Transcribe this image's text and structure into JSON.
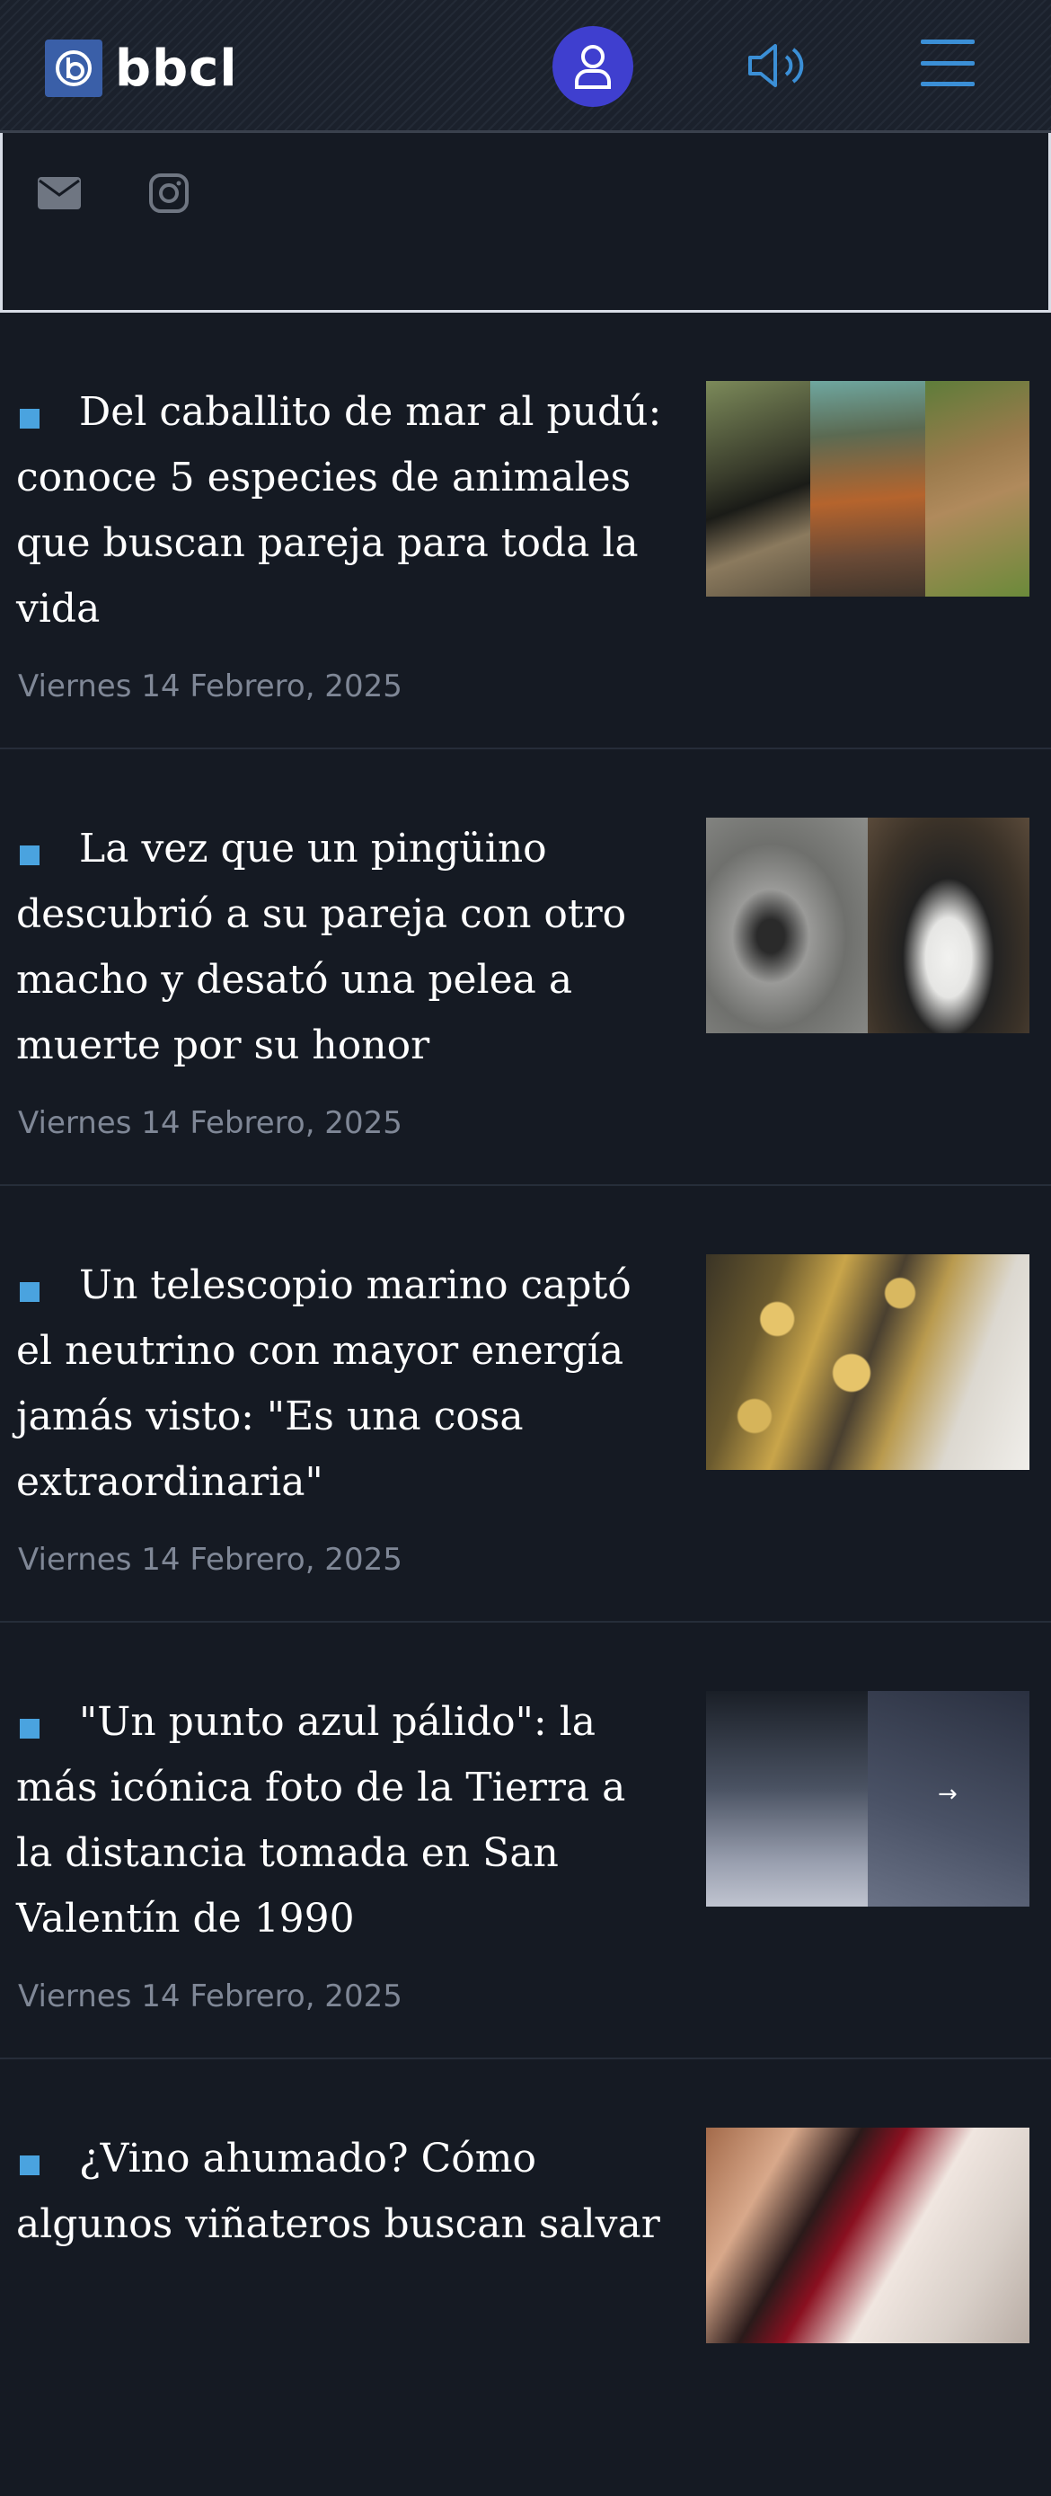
{
  "header": {
    "logo_text": "bbcl",
    "logo_icon": "bbcl-logo-icon",
    "user_icon": "user-icon",
    "audio_icon": "speaker-icon",
    "menu_icon": "hamburger-menu-icon",
    "accent": "#3f3fcf",
    "menu_color": "#3b8fd6"
  },
  "social": {
    "items": [
      {
        "icon": "mail-icon"
      },
      {
        "icon": "instagram-icon"
      }
    ]
  },
  "articles": [
    {
      "title": "Del caballito de mar al pudú: conoce 5 especies de animales que buscan pareja para toda la vida",
      "date": "Viernes 14 Febrero, 2025"
    },
    {
      "title": "La vez que un pingüino descubrió a su pareja con otro macho y desató una pelea a muerte por su honor",
      "date": "Viernes 14 Febrero, 2025"
    },
    {
      "title": "Un telescopio marino captó el neutrino con mayor energía jamás visto: \"Es una cosa extraordinaria\"",
      "date": "Viernes 14 Febrero, 2025"
    },
    {
      "title": "\"Un punto azul pálido\": la más icónica foto de la Tierra a la distancia tomada en San Valentín de 1990",
      "date": "Viernes 14 Febrero, 2025"
    },
    {
      "title": "¿Vino ahumado? Cómo algunos viñateros buscan salvar",
      "date": ""
    }
  ],
  "colors": {
    "background": "#151a23",
    "bullet": "#4aa3df",
    "date": "#7f8796"
  }
}
